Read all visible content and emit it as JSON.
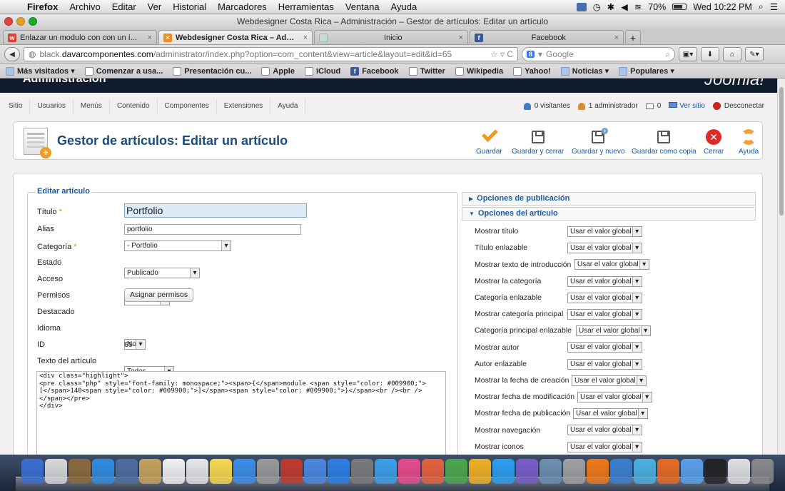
{
  "mac_menu": {
    "app": "Firefox",
    "items": [
      "Archivo",
      "Editar",
      "Ver",
      "Historial",
      "Marcadores",
      "Herramientas",
      "Ventana",
      "Ayuda"
    ],
    "battery": "70%",
    "clock": "Wed 10:22 PM"
  },
  "window_title": "Webdesigner Costa Rica – Administración – Gestor de artículos: Editar un artículo",
  "tabs": [
    {
      "title": "Enlazar un modulo con con un í...",
      "close": "×"
    },
    {
      "title": "Webdesigner Costa Rica – Admi...",
      "close": "×"
    },
    {
      "title": "Inicio",
      "close": "×"
    },
    {
      "title": "Facebook",
      "close": "×"
    }
  ],
  "new_tab": "+",
  "url": {
    "prefix": "black.",
    "domain": "davarcomponentes.com",
    "path": "/administrator/index.php?option=com_content&view=article&layout=edit&id=65"
  },
  "search_placeholder": "Google",
  "bookmarks": [
    "Más visitados ▾",
    "Comenzar a usa...",
    "Presentación cu...",
    "Apple",
    "iCloud",
    "Facebook",
    "Twitter",
    "Wikipedia",
    "Yahoo!",
    "Noticias ▾",
    "Populares ▾"
  ],
  "admin_header": {
    "title": "Administración",
    "logo": "Joomla!"
  },
  "admin_menu": [
    "Sitio",
    "Usuarios",
    "Menús",
    "Contenido",
    "Componentes",
    "Extensiones",
    "Ayuda"
  ],
  "status": {
    "visitors": "0 visitantes",
    "admins": "1 administrador",
    "messages": "0",
    "view_site": "Ver sitio",
    "logout": "Desconectar"
  },
  "page_title": "Gestor de artículos: Editar un artículo",
  "toolbar": {
    "save": "Guardar",
    "save_close": "Guardar y cerrar",
    "save_new": "Guardar y nuevo",
    "save_copy": "Guardar como copia",
    "close": "Cerrar",
    "help": "Ayuda"
  },
  "form": {
    "legend": "Editar artículo",
    "title_label": "Título",
    "title_value": "Portfolio",
    "alias_label": "Alias",
    "alias_value": "portfolio",
    "category_label": "Categoría",
    "category_value": "- Portfolio",
    "state_label": "Estado",
    "state_value": "Publicado",
    "access_label": "Acceso",
    "access_value": "Public",
    "permissions_label": "Permisos",
    "permissions_button": "Asignar permisos",
    "featured_label": "Destacado",
    "featured_value": "No",
    "language_label": "Idioma",
    "language_value": "Todos",
    "id_label": "ID",
    "id_value": "65",
    "text_label": "Texto del artículo",
    "required_mark": "*",
    "text_value": "<div class=\"highlight\">\n<pre class=\"php\" style=\"font-family: monospace;\"><span>{</span>module <span style=\"color: #009900;\">[</span>140<span style=\"color: #009900;\">]</span><span style=\"color: #009900;\">}</span><br /><br /></span></pre>\n</div>"
  },
  "panels": {
    "publishing": "Opciones de publicación",
    "article_options": "Opciones del artículo"
  },
  "article_options": [
    {
      "label": "Mostrar título",
      "value": "Usar el valor global"
    },
    {
      "label": "Título enlazable",
      "value": "Usar el valor global"
    },
    {
      "label": "Mostrar texto de introducción",
      "value": "Usar el valor global"
    },
    {
      "label": "Mostrar la categoría",
      "value": "Usar el valor global"
    },
    {
      "label": "Categoría enlazable",
      "value": "Usar el valor global"
    },
    {
      "label": "Mostrar categoría principal",
      "value": "Usar el valor global"
    },
    {
      "label": "Categoría principal enlazable",
      "value": "Usar el valor global"
    },
    {
      "label": "Mostrar autor",
      "value": "Usar el valor global"
    },
    {
      "label": "Autor enlazable",
      "value": "Usar el valor global"
    },
    {
      "label": "Mostrar la fecha de creación",
      "value": "Usar el valor global"
    },
    {
      "label": "Mostrar fecha de modificación",
      "value": "Usar el valor global"
    },
    {
      "label": "Mostrar fecha de publicación",
      "value": "Usar el valor global"
    },
    {
      "label": "Mostrar navegación",
      "value": "Usar el valor global"
    },
    {
      "label": "Mostrar iconos",
      "value": "Usar el valor global"
    }
  ],
  "dock_colors": [
    "#3b6fd0",
    "#d8d8d8",
    "#8a6a3a",
    "#2f8be0",
    "#4d6c9f",
    "#c7a15a",
    "#f2f2f2",
    "#e6e6e6",
    "#f7d94c",
    "#3c8ee8",
    "#999999",
    "#c0392b",
    "#4a88e0",
    "#2d7fe6",
    "#7a7a7a",
    "#39a0e8",
    "#e84a8a",
    "#e8603c",
    "#4aa84a",
    "#f0b020",
    "#2a9ff0",
    "#7a5dc8",
    "#6c8fb0",
    "#a0a0a0",
    "#f07818",
    "#3a7fd0",
    "#4ab0e0",
    "#e86a20",
    "#5aa0e8",
    "#222222",
    "#e0e0e0",
    "#888888"
  ]
}
